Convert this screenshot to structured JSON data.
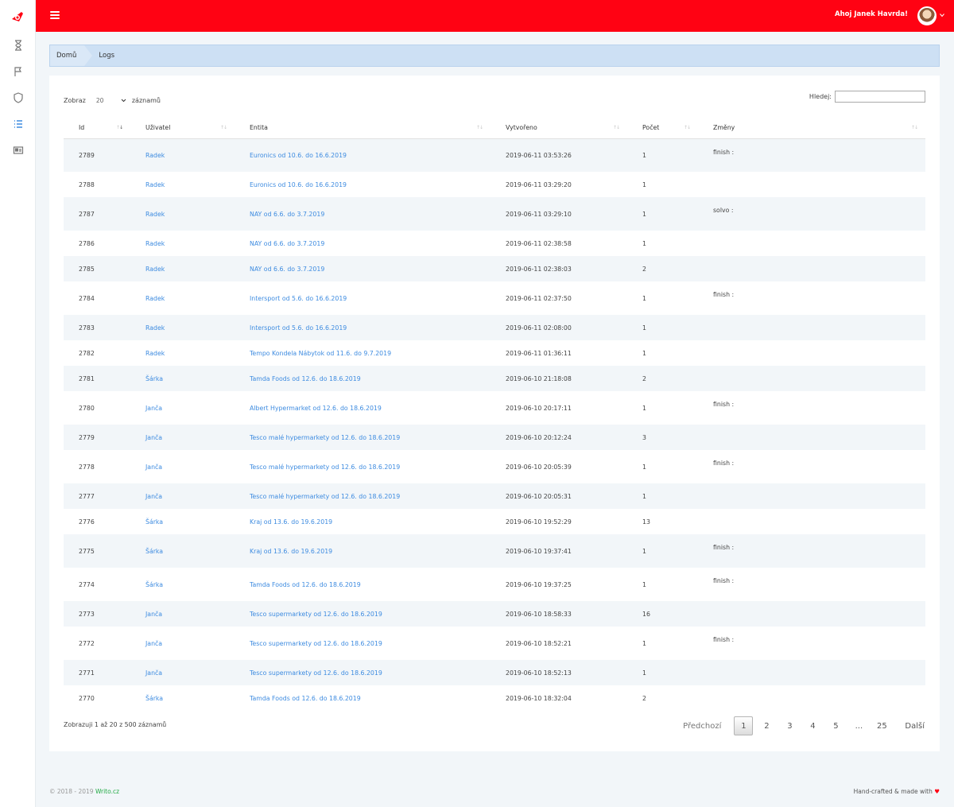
{
  "header": {
    "greeting": "Ahoj Janek Havrda!"
  },
  "sidebar": {
    "items": [
      {
        "icon": "hourglass-icon"
      },
      {
        "icon": "flag-icon"
      },
      {
        "icon": "shield-icon"
      },
      {
        "icon": "list-icon",
        "active": true
      },
      {
        "icon": "id-card-icon"
      }
    ]
  },
  "breadcrumb": {
    "home": "Domů",
    "current": "Logs"
  },
  "table_controls": {
    "show_label": "Zobraz",
    "page_size": "20",
    "entries_label": "záznamů",
    "search_label": "Hledej:",
    "search_value": ""
  },
  "table": {
    "columns": [
      "Id",
      "Uživatel",
      "Entita",
      "Vytvořeno",
      "Počet",
      "Změny"
    ],
    "rows": [
      {
        "id": "2789",
        "user": "Radek",
        "entity": "Euronics od 10.6. do 16.6.2019",
        "created": "2019-06-11 03:53:26",
        "count": "1",
        "changes": "finish :"
      },
      {
        "id": "2788",
        "user": "Radek",
        "entity": "Euronics od 10.6. do 16.6.2019",
        "created": "2019-06-11 03:29:20",
        "count": "1",
        "changes": ""
      },
      {
        "id": "2787",
        "user": "Radek",
        "entity": "NAY od 6.6. do 3.7.2019",
        "created": "2019-06-11 03:29:10",
        "count": "1",
        "changes": "solvo :"
      },
      {
        "id": "2786",
        "user": "Radek",
        "entity": "NAY od 6.6. do 3.7.2019",
        "created": "2019-06-11 02:38:58",
        "count": "1",
        "changes": ""
      },
      {
        "id": "2785",
        "user": "Radek",
        "entity": "NAY od 6.6. do 3.7.2019",
        "created": "2019-06-11 02:38:03",
        "count": "2",
        "changes": ""
      },
      {
        "id": "2784",
        "user": "Radek",
        "entity": "Intersport od 5.6. do 16.6.2019",
        "created": "2019-06-11 02:37:50",
        "count": "1",
        "changes": "finish :"
      },
      {
        "id": "2783",
        "user": "Radek",
        "entity": "Intersport od 5.6. do 16.6.2019",
        "created": "2019-06-11 02:08:00",
        "count": "1",
        "changes": ""
      },
      {
        "id": "2782",
        "user": "Radek",
        "entity": "Tempo Kondela Nábytok od 11.6. do 9.7.2019",
        "created": "2019-06-11 01:36:11",
        "count": "1",
        "changes": ""
      },
      {
        "id": "2781",
        "user": "Šárka",
        "entity": "Tamda Foods od 12.6. do 18.6.2019",
        "created": "2019-06-10 21:18:08",
        "count": "2",
        "changes": ""
      },
      {
        "id": "2780",
        "user": "Janča",
        "entity": "Albert Hypermarket od 12.6. do 18.6.2019",
        "created": "2019-06-10 20:17:11",
        "count": "1",
        "changes": "finish :"
      },
      {
        "id": "2779",
        "user": "Janča",
        "entity": "Tesco malé hypermarkety od 12.6. do 18.6.2019",
        "created": "2019-06-10 20:12:24",
        "count": "3",
        "changes": ""
      },
      {
        "id": "2778",
        "user": "Janča",
        "entity": "Tesco malé hypermarkety od 12.6. do 18.6.2019",
        "created": "2019-06-10 20:05:39",
        "count": "1",
        "changes": "finish :"
      },
      {
        "id": "2777",
        "user": "Janča",
        "entity": "Tesco malé hypermarkety od 12.6. do 18.6.2019",
        "created": "2019-06-10 20:05:31",
        "count": "1",
        "changes": ""
      },
      {
        "id": "2776",
        "user": "Šárka",
        "entity": "Kraj od 13.6. do 19.6.2019",
        "created": "2019-06-10 19:52:29",
        "count": "13",
        "changes": ""
      },
      {
        "id": "2775",
        "user": "Šárka",
        "entity": "Kraj od 13.6. do 19.6.2019",
        "created": "2019-06-10 19:37:41",
        "count": "1",
        "changes": "finish :"
      },
      {
        "id": "2774",
        "user": "Šárka",
        "entity": "Tamda Foods od 12.6. do 18.6.2019",
        "created": "2019-06-10 19:37:25",
        "count": "1",
        "changes": "finish :"
      },
      {
        "id": "2773",
        "user": "Janča",
        "entity": "Tesco supermarkety od 12.6. do 18.6.2019",
        "created": "2019-06-10 18:58:33",
        "count": "16",
        "changes": ""
      },
      {
        "id": "2772",
        "user": "Janča",
        "entity": "Tesco supermarkety od 12.6. do 18.6.2019",
        "created": "2019-06-10 18:52:21",
        "count": "1",
        "changes": "finish :"
      },
      {
        "id": "2771",
        "user": "Janča",
        "entity": "Tesco supermarkety od 12.6. do 18.6.2019",
        "created": "2019-06-10 18:52:13",
        "count": "1",
        "changes": ""
      },
      {
        "id": "2770",
        "user": "Šárka",
        "entity": "Tamda Foods od 12.6. do 18.6.2019",
        "created": "2019-06-10 18:32:04",
        "count": "2",
        "changes": ""
      }
    ]
  },
  "pagination": {
    "info": "Zobrazuji 1 až 20 z 500 záznamů",
    "prev": "Předchozí",
    "pages": [
      "1",
      "2",
      "3",
      "4",
      "5",
      "...",
      "25"
    ],
    "current": "1",
    "next": "Další"
  },
  "footer": {
    "copyright": "© 2018 - 2019",
    "brand": "Writo.cz",
    "credit": "Hand-crafted & made with"
  },
  "colors": {
    "topbar": "#ff0213",
    "link": "#3d8be0",
    "breadcrumb": "#cde0f4",
    "stripe": "#f2f6f9"
  }
}
